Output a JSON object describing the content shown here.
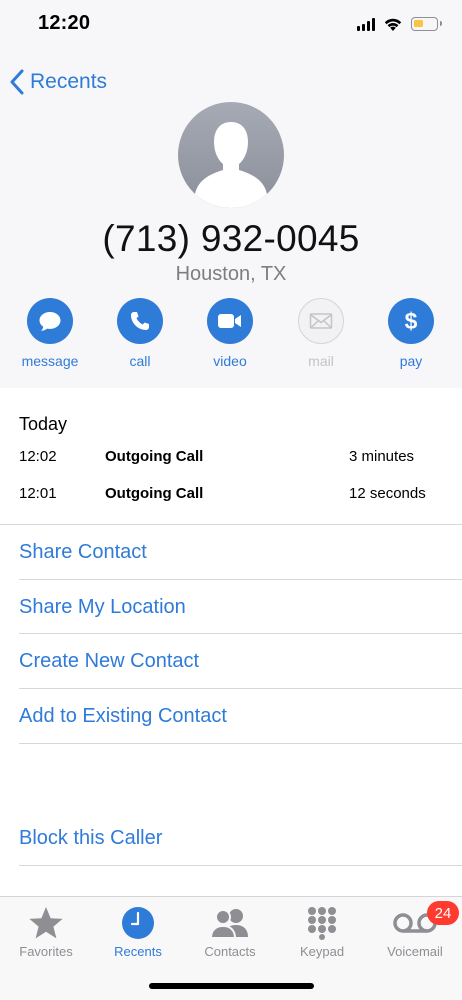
{
  "status_bar": {
    "time": "12:20",
    "battery_color": "#f7c640"
  },
  "nav": {
    "back_label": "Recents",
    "back_icon": "chevron-left-icon"
  },
  "contact": {
    "phone": "(713) 932-0045",
    "location": "Houston, TX",
    "avatar_icon": "person-silhouette-icon"
  },
  "actions": [
    {
      "label": "message",
      "icon": "speech-bubble-icon",
      "enabled": true
    },
    {
      "label": "call",
      "icon": "phone-icon",
      "enabled": true
    },
    {
      "label": "video",
      "icon": "video-camera-icon",
      "enabled": true
    },
    {
      "label": "mail",
      "icon": "envelope-icon",
      "enabled": false
    },
    {
      "label": "pay",
      "icon": "dollar-icon",
      "enabled": true
    }
  ],
  "recents": {
    "day_label": "Today",
    "calls": [
      {
        "time": "12:02",
        "kind": "Outgoing Call",
        "duration": "3 minutes"
      },
      {
        "time": "12:01",
        "kind": "Outgoing Call",
        "duration": "12 seconds"
      }
    ]
  },
  "options": {
    "share_contact": "Share Contact",
    "share_location": "Share My Location",
    "create_contact": "Create New Contact",
    "add_existing": "Add to Existing Contact",
    "block_caller": "Block this Caller"
  },
  "tabs": [
    {
      "label": "Favorites",
      "icon": "star-icon",
      "active": false
    },
    {
      "label": "Recents",
      "icon": "clock-icon",
      "active": true
    },
    {
      "label": "Contacts",
      "icon": "contacts-icon",
      "active": false
    },
    {
      "label": "Keypad",
      "icon": "keypad-icon",
      "active": false
    },
    {
      "label": "Voicemail",
      "icon": "voicemail-icon",
      "active": false,
      "badge": "24"
    }
  ],
  "colors": {
    "accent": "#2f7bd8",
    "badge": "#ff3b30",
    "header_bg": "#f7f7f9"
  }
}
